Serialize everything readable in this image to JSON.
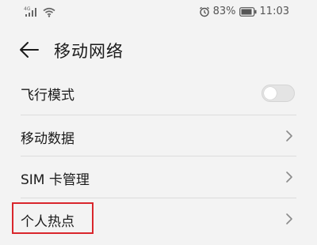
{
  "status_bar": {
    "signal_label": "4G",
    "battery_percent": "83%",
    "time": "11:03",
    "icons": [
      "signal-icon",
      "wifi-icon",
      "alarm-icon",
      "battery-icon"
    ]
  },
  "header": {
    "back_icon": "arrow-left-icon",
    "title": "移动网络"
  },
  "settings": {
    "items": [
      {
        "label": "飞行模式",
        "control": "toggle",
        "toggle_on": false
      },
      {
        "label": "移动数据",
        "control": "chevron"
      },
      {
        "label": "SIM 卡管理",
        "control": "chevron"
      },
      {
        "label": "个人热点",
        "control": "chevron",
        "highlighted": true
      }
    ]
  },
  "colors": {
    "background": "#f3f3f3",
    "highlight": "#d9262c",
    "divider": "#dcdcdc"
  }
}
